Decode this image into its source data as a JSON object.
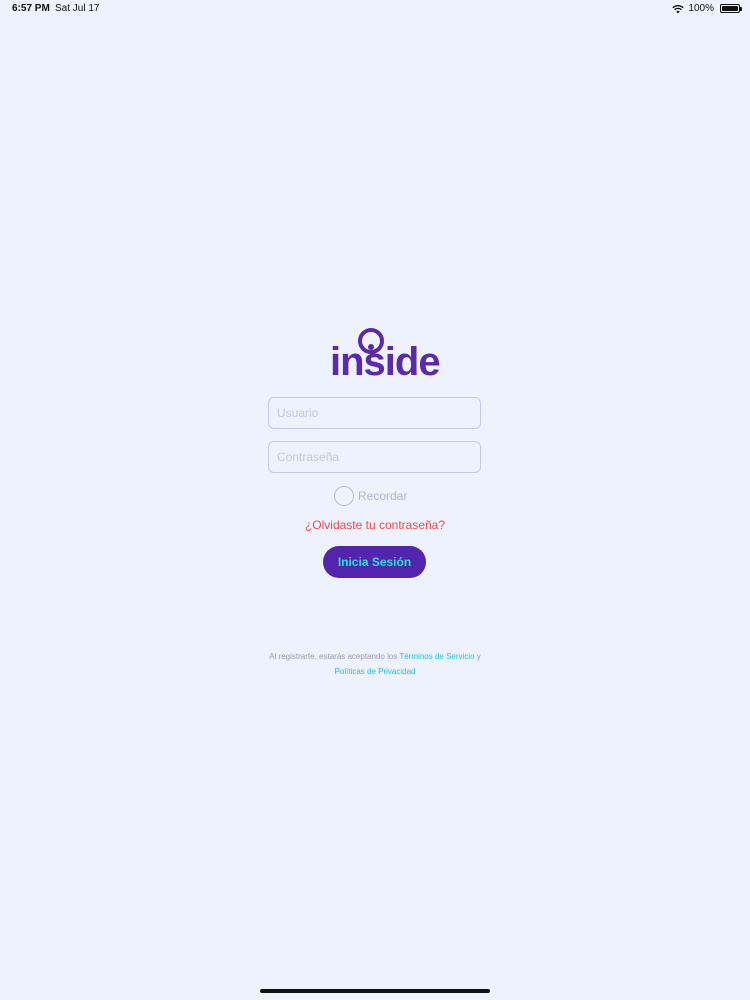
{
  "status_bar": {
    "time": "6:57 PM",
    "date": "Sat Jul 17",
    "battery": "100%"
  },
  "logo": {
    "text": "inside",
    "color": "#5a2aa8"
  },
  "form": {
    "username_placeholder": "Usuario",
    "password_placeholder": "Contraseña",
    "remember_label": "Recordar",
    "forgot_label": "¿Olvidaste tu contraseña?",
    "login_label": "Inicia Sesión"
  },
  "legal": {
    "prefix": "Al registrarte, estarás aceptando los ",
    "terms_label": "Términos de Servicio",
    "conjunction": " y",
    "privacy_label": "Políticas de Privacidad"
  },
  "colors": {
    "background": "#eef2fc",
    "accent": "#5324ad",
    "button_text": "#2ee0d8",
    "link": "#1cc4dc",
    "error_link": "#f04a4a"
  }
}
